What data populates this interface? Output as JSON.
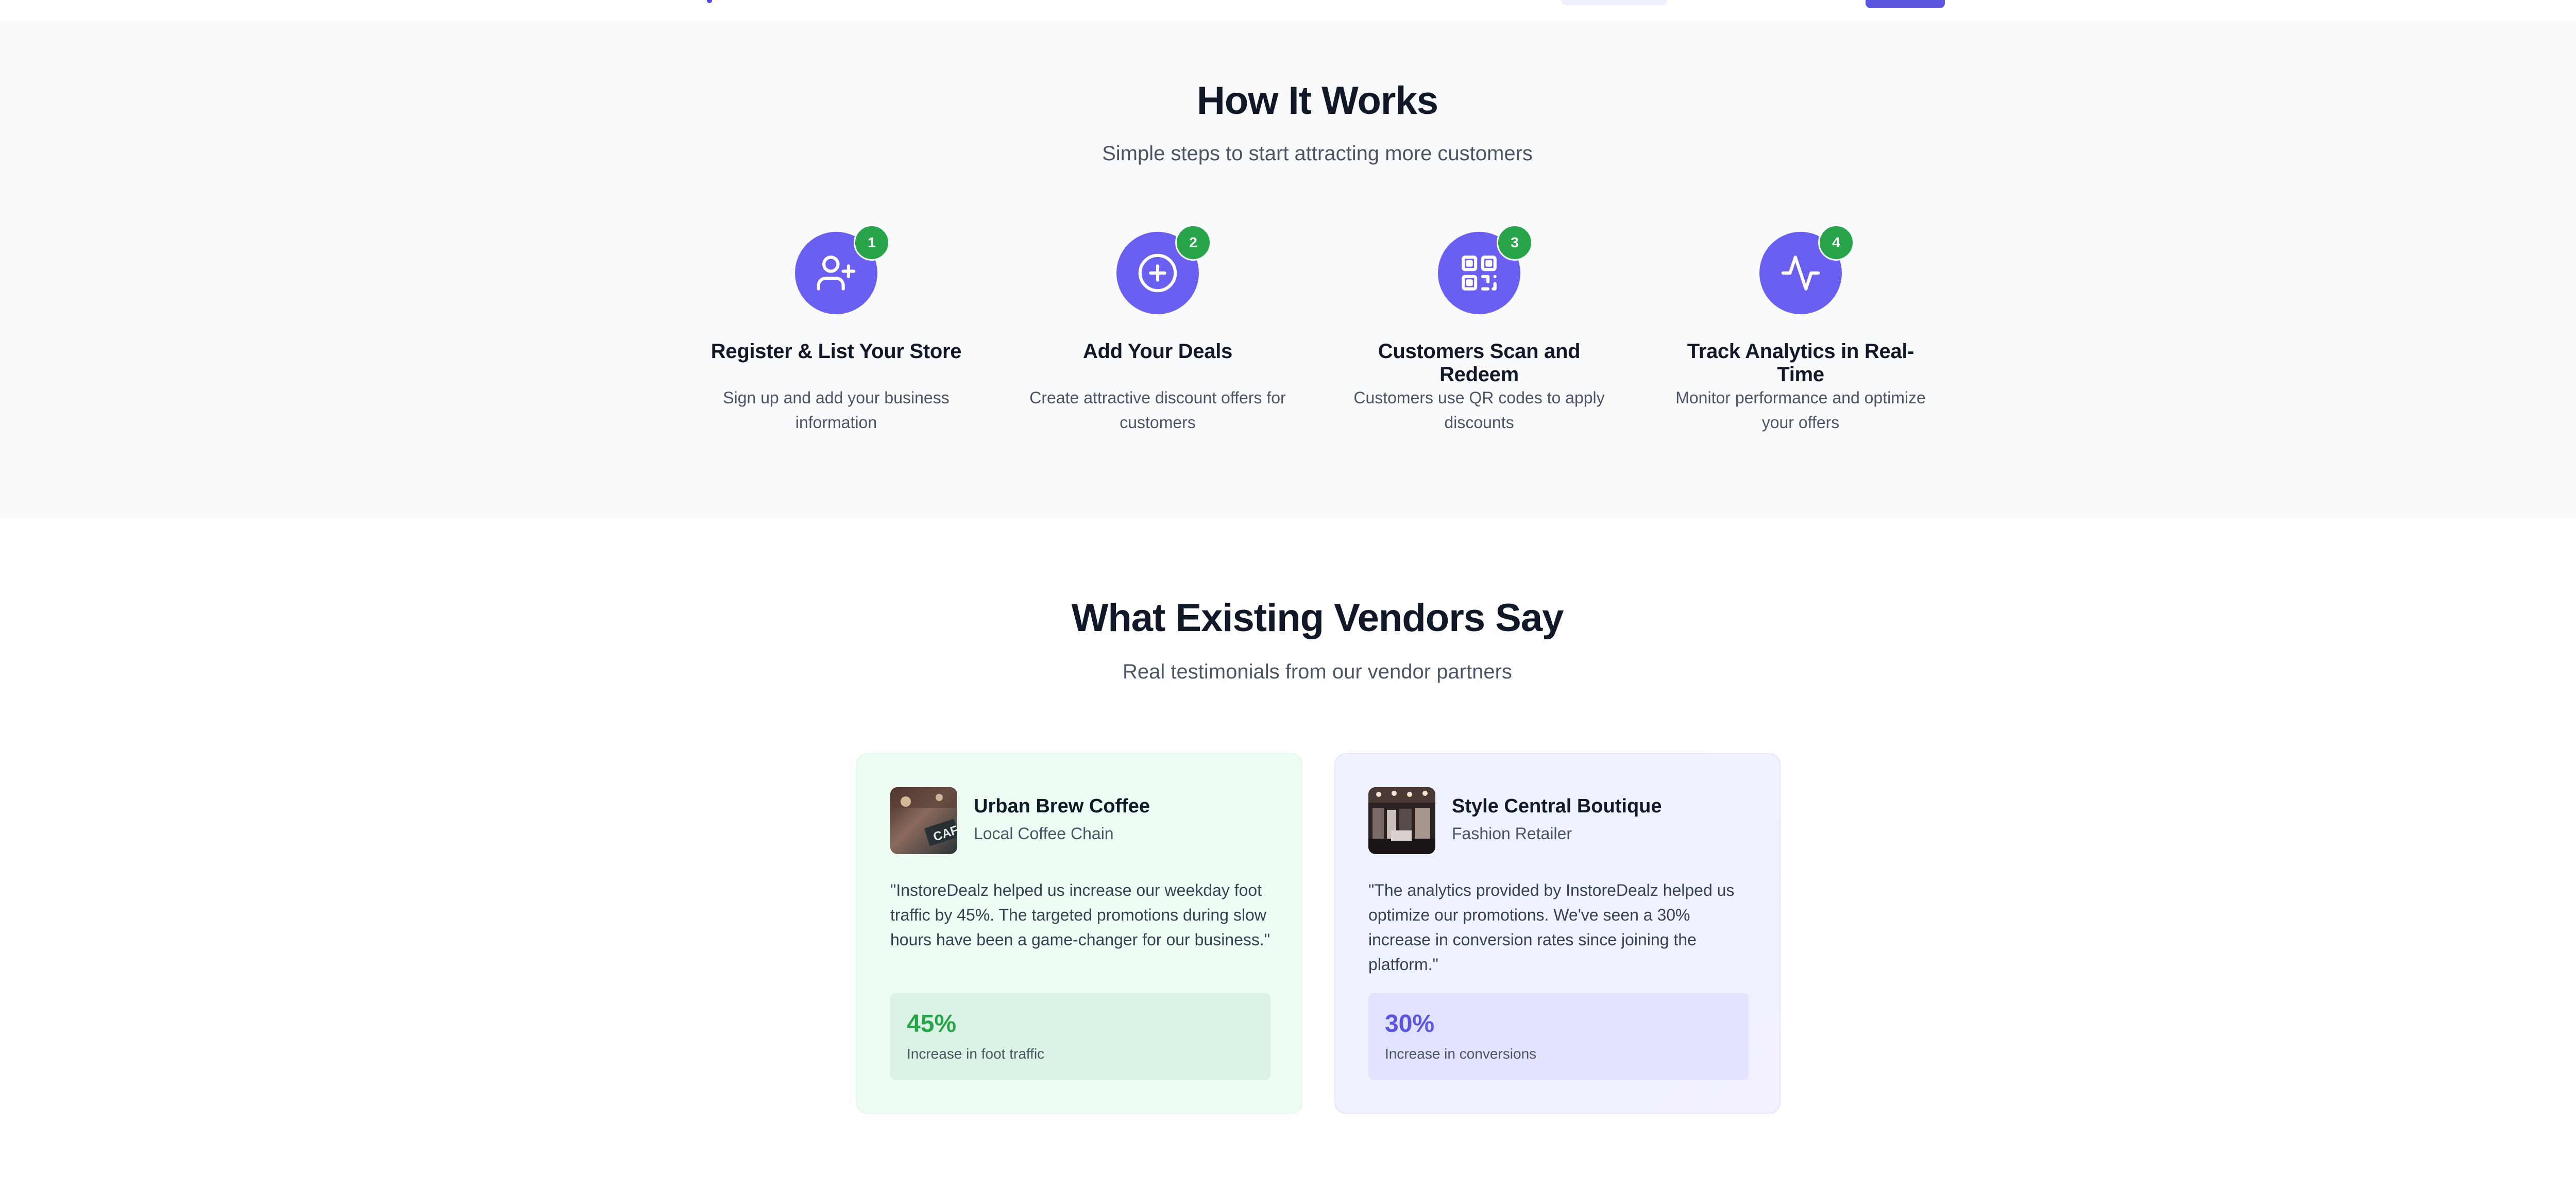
{
  "colors": {
    "primary": "#6a5ff0",
    "badge_green": "#28a44a",
    "heading": "#111827",
    "muted": "#4b5563"
  },
  "how_it_works": {
    "title": "How It Works",
    "subtitle": "Simple steps to start attracting more customers",
    "steps": [
      {
        "number": "1",
        "icon": "user-plus-icon",
        "title": "Register & List Your Store",
        "description": "Sign up and add your business information"
      },
      {
        "number": "2",
        "icon": "plus-circle-icon",
        "title": "Add Your Deals",
        "description": "Create attractive discount offers for customers"
      },
      {
        "number": "3",
        "icon": "qr-code-icon",
        "title": "Customers Scan and Redeem",
        "description": "Customers use QR codes to apply discounts"
      },
      {
        "number": "4",
        "icon": "activity-icon",
        "title": "Track Analytics in Real-Time",
        "description": "Monitor performance and optimize your offers"
      }
    ]
  },
  "testimonials": {
    "title": "What Existing Vendors Say",
    "subtitle": "Real testimonials from our vendor partners",
    "cards": [
      {
        "name": "Urban Brew Coffee",
        "type": "Local Coffee Chain",
        "avatar_sign": "CAF",
        "quote": "\"InstoreDealz helped us increase our weekday foot traffic by 45%. The targeted promotions during slow hours have been a game-changer for our business.\"",
        "metric_value": "45%",
        "metric_label": "Increase in foot traffic"
      },
      {
        "name": "Style Central Boutique",
        "type": "Fashion Retailer",
        "quote": "\"The analytics provided by InstoreDealz helped us optimize our promotions. We've seen a 30% increase in conversion rates since joining the platform.\"",
        "metric_value": "30%",
        "metric_label": "Increase in conversions"
      }
    ]
  }
}
